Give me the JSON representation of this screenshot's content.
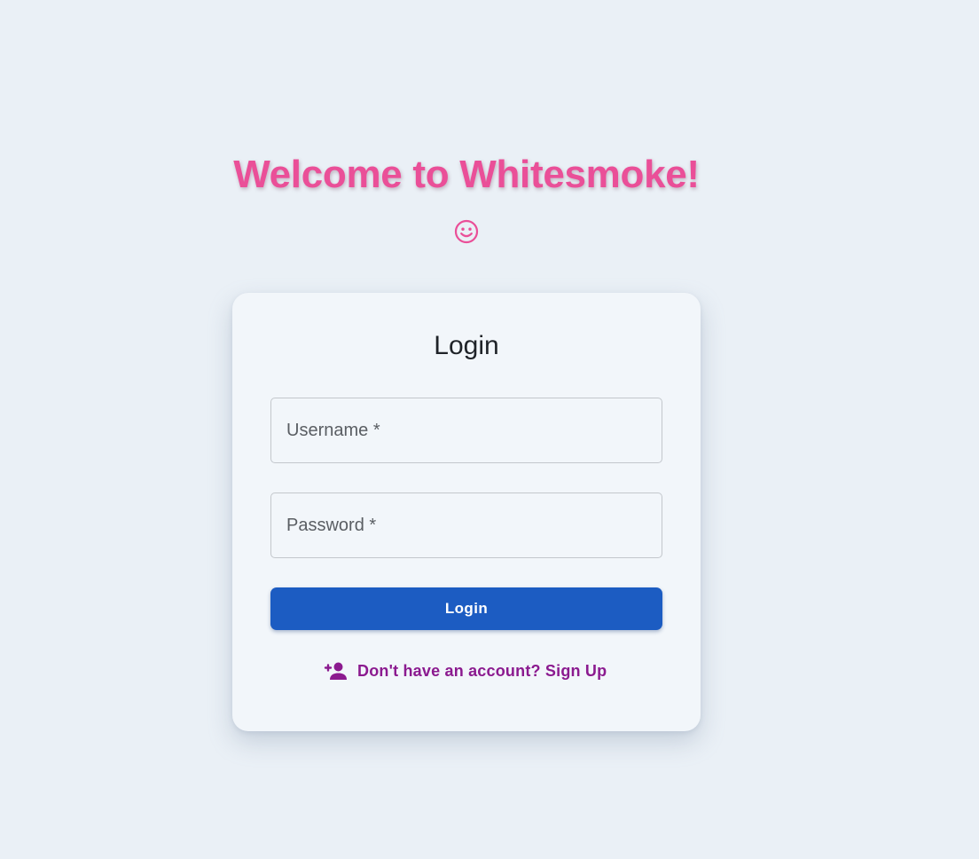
{
  "header": {
    "welcome_text": "Welcome to Whitesmoke!",
    "smile_icon": "smiley-face-icon"
  },
  "login_card": {
    "title": "Login",
    "username_placeholder": "Username *",
    "password_placeholder": "Password *",
    "login_button_label": "Login",
    "signup_link_text": "Don't have an account? Sign Up",
    "signup_icon": "person-add-icon"
  },
  "colors": {
    "background": "#eaf0f6",
    "card": "#f2f6fa",
    "welcome_pink": "#ea4f98",
    "primary_blue": "#1c5cc2",
    "link_purple": "#8b1a8f"
  }
}
